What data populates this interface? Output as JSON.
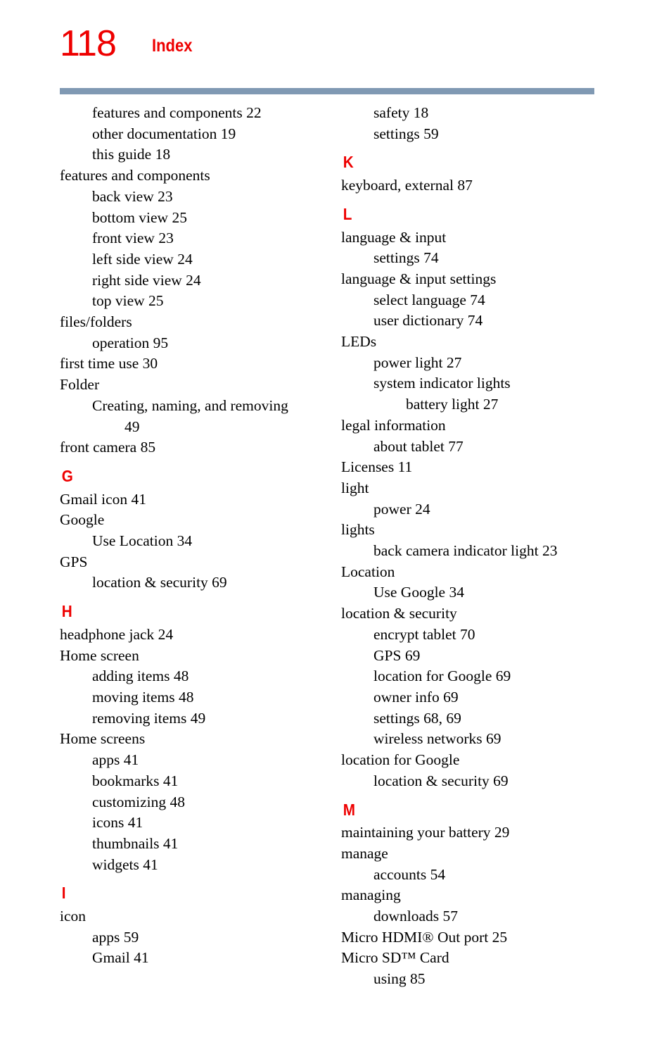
{
  "header": {
    "page_number": "118",
    "title": "Index",
    "rule_color": "#8099b3",
    "accent_color": "#ee0000"
  },
  "columns": [
    {
      "name": "left-column",
      "entries": [
        {
          "type": "entry",
          "level": 2,
          "text": "features and components 22"
        },
        {
          "type": "entry",
          "level": 2,
          "text": "other documentation 19"
        },
        {
          "type": "entry",
          "level": 2,
          "text": "this guide 18"
        },
        {
          "type": "entry",
          "level": 1,
          "text": "features and components"
        },
        {
          "type": "entry",
          "level": 2,
          "text": "back view 23"
        },
        {
          "type": "entry",
          "level": 2,
          "text": "bottom view 25"
        },
        {
          "type": "entry",
          "level": 2,
          "text": "front view 23"
        },
        {
          "type": "entry",
          "level": 2,
          "text": "left side view 24"
        },
        {
          "type": "entry",
          "level": 2,
          "text": "right side view 24"
        },
        {
          "type": "entry",
          "level": 2,
          "text": "top view 25"
        },
        {
          "type": "entry",
          "level": 1,
          "text": "files/folders"
        },
        {
          "type": "entry",
          "level": 2,
          "text": "operation 95"
        },
        {
          "type": "entry",
          "level": 1,
          "text": "first time use 30"
        },
        {
          "type": "entry",
          "level": 1,
          "text": "Folder"
        },
        {
          "type": "wrap",
          "level": 2,
          "text": "Creating, naming, and removing",
          "continuation": "49"
        },
        {
          "type": "entry",
          "level": 1,
          "text": "front camera 85"
        },
        {
          "type": "letter",
          "text": "G"
        },
        {
          "type": "entry",
          "level": 1,
          "text": "Gmail icon 41"
        },
        {
          "type": "entry",
          "level": 1,
          "text": "Google"
        },
        {
          "type": "entry",
          "level": 2,
          "text": "Use Location 34"
        },
        {
          "type": "entry",
          "level": 1,
          "text": "GPS"
        },
        {
          "type": "entry",
          "level": 2,
          "text": "location & security 69"
        },
        {
          "type": "letter",
          "text": "H"
        },
        {
          "type": "entry",
          "level": 1,
          "text": "headphone jack 24"
        },
        {
          "type": "entry",
          "level": 1,
          "text": "Home screen"
        },
        {
          "type": "entry",
          "level": 2,
          "text": "adding items 48"
        },
        {
          "type": "entry",
          "level": 2,
          "text": "moving items 48"
        },
        {
          "type": "entry",
          "level": 2,
          "text": "removing items 49"
        },
        {
          "type": "entry",
          "level": 1,
          "text": "Home screens"
        },
        {
          "type": "entry",
          "level": 2,
          "text": "apps 41"
        },
        {
          "type": "entry",
          "level": 2,
          "text": "bookmarks 41"
        },
        {
          "type": "entry",
          "level": 2,
          "text": "customizing 48"
        },
        {
          "type": "entry",
          "level": 2,
          "text": "icons 41"
        },
        {
          "type": "entry",
          "level": 2,
          "text": "thumbnails 41"
        },
        {
          "type": "entry",
          "level": 2,
          "text": "widgets 41"
        },
        {
          "type": "letter",
          "text": "I"
        },
        {
          "type": "entry",
          "level": 1,
          "text": "icon"
        },
        {
          "type": "entry",
          "level": 2,
          "text": "apps 59"
        },
        {
          "type": "entry",
          "level": 2,
          "text": "Gmail 41"
        }
      ]
    },
    {
      "name": "right-column",
      "entries": [
        {
          "type": "entry",
          "level": 2,
          "text": "safety 18"
        },
        {
          "type": "entry",
          "level": 2,
          "text": "settings 59"
        },
        {
          "type": "letter",
          "text": "K"
        },
        {
          "type": "entry",
          "level": 1,
          "text": "keyboard, external 87"
        },
        {
          "type": "letter",
          "text": "L"
        },
        {
          "type": "entry",
          "level": 1,
          "text": "language & input"
        },
        {
          "type": "entry",
          "level": 2,
          "text": "settings 74"
        },
        {
          "type": "entry",
          "level": 1,
          "text": "language & input settings"
        },
        {
          "type": "entry",
          "level": 2,
          "text": "select language 74"
        },
        {
          "type": "entry",
          "level": 2,
          "text": "user dictionary 74"
        },
        {
          "type": "entry",
          "level": 1,
          "text": "LEDs"
        },
        {
          "type": "entry",
          "level": 2,
          "text": "power light 27"
        },
        {
          "type": "entry",
          "level": 2,
          "text": "system indicator lights"
        },
        {
          "type": "entry",
          "level": 3,
          "text": "battery light 27"
        },
        {
          "type": "entry",
          "level": 1,
          "text": "legal information"
        },
        {
          "type": "entry",
          "level": 2,
          "text": "about tablet 77"
        },
        {
          "type": "entry",
          "level": 1,
          "text": "Licenses 11"
        },
        {
          "type": "entry",
          "level": 1,
          "text": "light"
        },
        {
          "type": "entry",
          "level": 2,
          "text": "power 24"
        },
        {
          "type": "entry",
          "level": 1,
          "text": "lights"
        },
        {
          "type": "entry",
          "level": 2,
          "text": "back camera indicator light 23"
        },
        {
          "type": "entry",
          "level": 1,
          "text": "Location"
        },
        {
          "type": "entry",
          "level": 2,
          "text": "Use Google 34"
        },
        {
          "type": "entry",
          "level": 1,
          "text": "location & security"
        },
        {
          "type": "entry",
          "level": 2,
          "text": "encrypt tablet 70"
        },
        {
          "type": "entry",
          "level": 2,
          "text": "GPS 69"
        },
        {
          "type": "entry",
          "level": 2,
          "text": "location for Google 69"
        },
        {
          "type": "entry",
          "level": 2,
          "text": "owner info 69"
        },
        {
          "type": "entry",
          "level": 2,
          "text": "settings 68, 69"
        },
        {
          "type": "entry",
          "level": 2,
          "text": "wireless networks 69"
        },
        {
          "type": "entry",
          "level": 1,
          "text": "location for Google"
        },
        {
          "type": "entry",
          "level": 2,
          "text": "location & security 69"
        },
        {
          "type": "letter",
          "text": "M"
        },
        {
          "type": "entry",
          "level": 1,
          "text": "maintaining your battery 29"
        },
        {
          "type": "entry",
          "level": 1,
          "text": "manage"
        },
        {
          "type": "entry",
          "level": 2,
          "text": "accounts 54"
        },
        {
          "type": "entry",
          "level": 1,
          "text": "managing"
        },
        {
          "type": "entry",
          "level": 2,
          "text": "downloads 57"
        },
        {
          "type": "entry",
          "level": 1,
          "text": "Micro HDMI® Out port 25"
        },
        {
          "type": "entry",
          "level": 1,
          "text": "Micro SD™ Card"
        },
        {
          "type": "entry",
          "level": 2,
          "text": "using 85"
        }
      ]
    }
  ]
}
